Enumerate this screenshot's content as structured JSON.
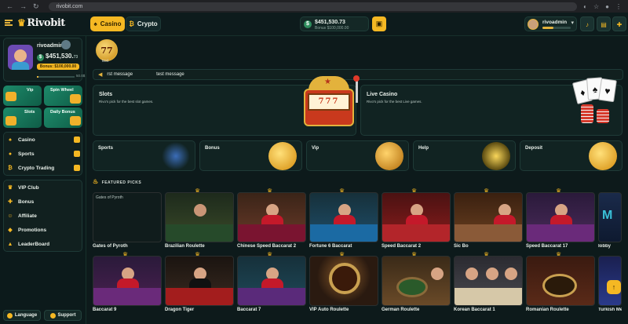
{
  "browser": {
    "url": "rivobit.com"
  },
  "header": {
    "logo": "Rivobit",
    "tabs": [
      {
        "label": "Casino"
      },
      {
        "label": "Crypto"
      }
    ],
    "balance": {
      "amount": "$451,530.73",
      "bonus": "Bonus $100,000.00"
    },
    "username": "rivoadmin"
  },
  "sidebar": {
    "profile": {
      "username": "rivoadmin",
      "balance": "$451,530.",
      "balance_cents": "73",
      "bonus": "Bonus: $100,000.00",
      "progress_label": "50.0$",
      "progress": 0.05
    },
    "quick": [
      "Vip",
      "Spin Wheel",
      "Slots",
      "Daily Bonus"
    ],
    "menu_group1": [
      "Casino",
      "Sports",
      "Crypto Trading"
    ],
    "menu_group2": [
      "VIP Club",
      "Bonus",
      "Affiliate",
      "Promotions",
      "LeaderBoard"
    ],
    "bottom": [
      "Language",
      "Support"
    ]
  },
  "main": {
    "story": {
      "label": "test",
      "badge": "77"
    },
    "ticker": [
      "rst message",
      "test message"
    ],
    "slots": {
      "title": "Slots",
      "subtitle": "Rivo's pick for the best slot games.",
      "reels": "777"
    },
    "live": {
      "title": "Live Casino",
      "subtitle": "Rivo's pick for the best Live games."
    },
    "categories": [
      "Sports",
      "Bonus",
      "Vip",
      "Help",
      "Deposit"
    ],
    "featured": "FEATURED PICKS",
    "broken_image_alt": "Gates of Pyroth",
    "games_row1": [
      "Gates of Pyroth",
      "Brazilian Roulette",
      "Chinese Speed Baccarat 2",
      "Fortune 6 Baccarat",
      "Speed Baccarat 2",
      "Sic Bo",
      "Speed Baccarat 17",
      "lobby"
    ],
    "games_row2": [
      "Baccarat 9",
      "Dragon Tiger",
      "Baccarat 7",
      "VIP Auto Roulette",
      "German Roulette",
      "Korean Baccarat 1",
      "Romanian Roulette",
      "Turkish Me"
    ]
  },
  "colors": {
    "accent": "#f5b823",
    "bg": "#0b1516",
    "panel": "#11201f",
    "green": "#1d8a6a"
  }
}
